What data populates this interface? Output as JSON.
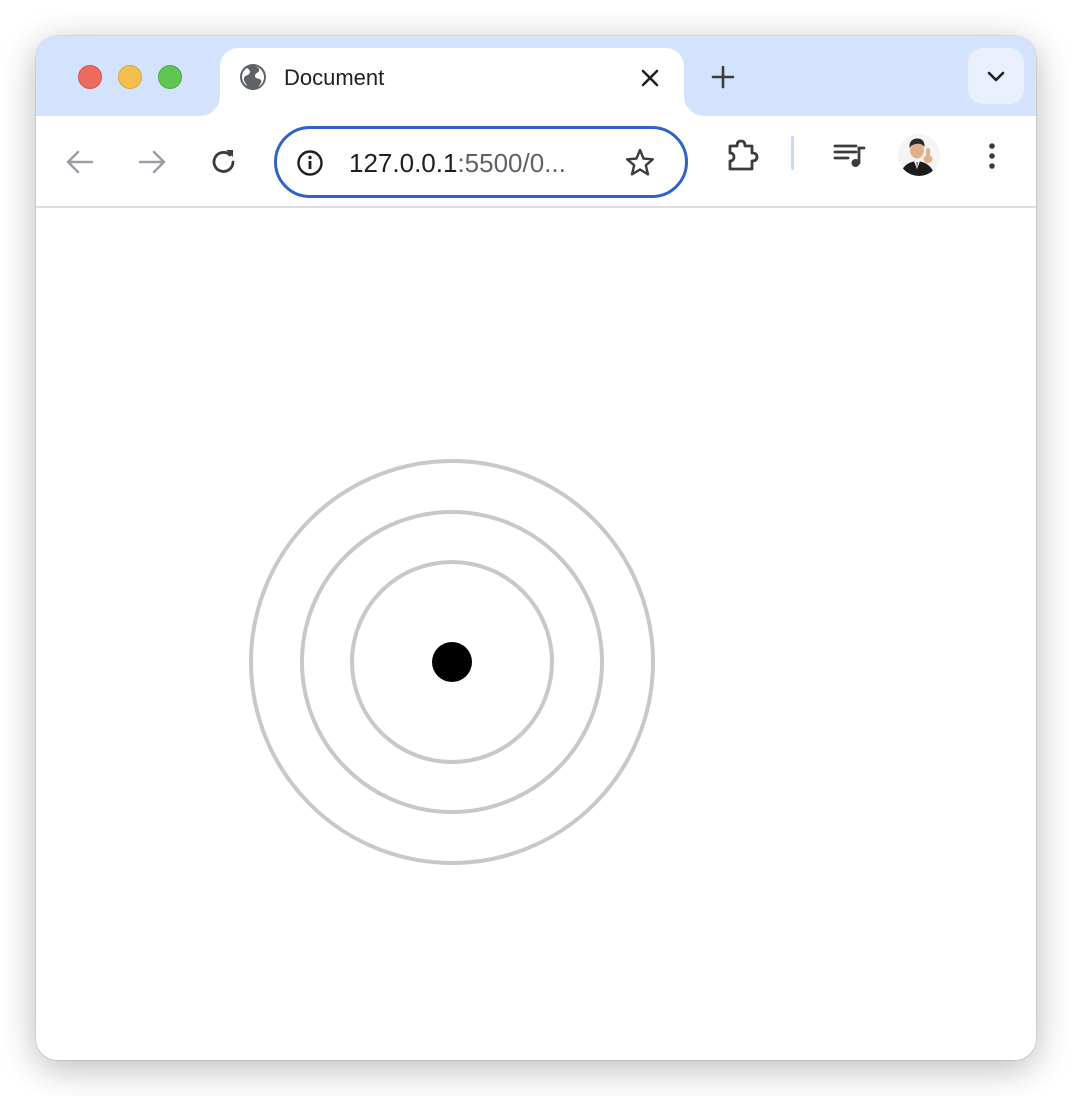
{
  "window": {
    "controls": [
      "close",
      "minimize",
      "maximize"
    ]
  },
  "tab": {
    "title": "Document",
    "favicon": "globe-icon"
  },
  "toolbar": {
    "icons": [
      "back-arrow-icon",
      "forward-arrow-icon",
      "reload-icon",
      "extensions-puzzle-icon",
      "media-queue-icon",
      "kebab-menu-icon"
    ]
  },
  "omnibox": {
    "url_host": "127.0.0.1",
    "url_rest": ":5500/0..."
  },
  "colors": {
    "tabstrip": "#d3e3fd",
    "omnibox_border": "#2f63c4",
    "ring": "#c8c8c8",
    "dot": "#000000"
  },
  "page": {
    "rings": 3,
    "center_dot": true
  }
}
